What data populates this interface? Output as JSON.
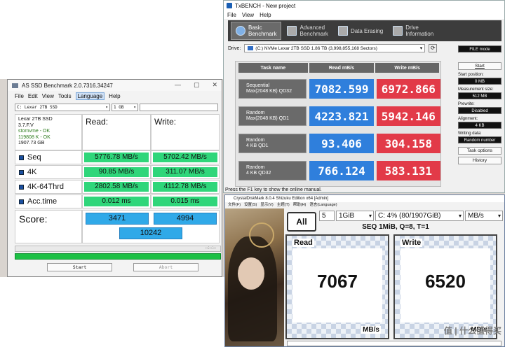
{
  "txbench": {
    "title": "TxBENCH - New project",
    "menu": [
      "File",
      "View",
      "Help"
    ],
    "tabs": [
      {
        "line1": "Basic",
        "line2": "Benchmark"
      },
      {
        "line1": "Advanced",
        "line2": "Benchmark"
      },
      {
        "line1": "Data Erasing",
        "line2": ""
      },
      {
        "line1": "Drive",
        "line2": "Information"
      }
    ],
    "drive_label": "Drive:",
    "drive_value": "(C:) NVMe Lexar 2TB SSD   1.86 TB (3,998,855,168 Sectors)",
    "file_mode": "FILE mode",
    "start": "Start",
    "start_position_label": "Start position:",
    "start_position": "0 MB",
    "measurement_size_label": "Measurement size:",
    "measurement_size": "512 MB",
    "prewrite_label": "Prewrite:",
    "prewrite": "Disabled",
    "alignment_label": "Alignment:",
    "alignment": "4 KB",
    "writing_data_label": "Writing data:",
    "writing_data": "Random number",
    "task_options": "Task options",
    "history": "History",
    "col_task": "Task name",
    "col_read": "Read mB/s",
    "col_write": "Write mB/s",
    "rows": [
      {
        "l1": "Sequential",
        "l2": "Max(2048 KB) QD32",
        "read": "7082.599",
        "write": "6972.866"
      },
      {
        "l1": "Random",
        "l2": "Max(2048 KB) QD1",
        "read": "4223.821",
        "write": "5942.146"
      },
      {
        "l1": "Random",
        "l2": "4 KB QD1",
        "read": "93.406",
        "write": "304.158"
      },
      {
        "l1": "Random",
        "l2": "4 KB QD32",
        "read": "766.124",
        "write": "583.131"
      }
    ],
    "status": "Press the F1 key to show the online manual."
  },
  "asssd": {
    "title": "AS SSD Benchmark 2.0.7316.34247",
    "menu": [
      "File",
      "Edit",
      "View",
      "Tools",
      "Language",
      "Help"
    ],
    "drive_select": "C: Lexar 2TB SSD",
    "size_select": "1 GB",
    "info": [
      "Lexar 2TB SSD",
      "3.7.F.V",
      "stornvme - OK",
      "119808 K - OK",
      "1907.73 GB"
    ],
    "read_head": "Read:",
    "write_head": "Write:",
    "tests": [
      {
        "name": "Seq",
        "read": "5776.78 MB/s",
        "write": "5702.42 MB/s"
      },
      {
        "name": "4K",
        "read": "90.85 MB/s",
        "write": "311.07 MB/s"
      },
      {
        "name": "4K-64Thrd",
        "read": "2802.58 MB/s",
        "write": "4112.78 MB/s"
      },
      {
        "name": "Acc.time",
        "read": "0.012 ms",
        "write": "0.015 ms"
      }
    ],
    "score_label": "Score:",
    "score_read": "3471",
    "score_write": "4994",
    "score_total": "10242",
    "progress_time": "--:--:--",
    "start": "Start",
    "abort": "Abort"
  },
  "cdm": {
    "title": "CrystalDiskMark 8.0.4 Shizuku Edition x64 [Admin]",
    "menu": [
      "文件(F)",
      "设置(S)",
      "显示(V)",
      "主题(T)",
      "帮助(H)",
      "语言(Language)"
    ],
    "all": "All",
    "count": "5",
    "size": "1GiB",
    "drive": "C: 4% (80/1907GiB)",
    "unit": "MB/s",
    "heading": "SEQ 1MiB, Q=8, T=1",
    "read_label": "Read",
    "write_label": "Write",
    "read_value": "7067",
    "write_value": "6520",
    "value_unit": "MB/s",
    "watermark": "值 | 什么值得买"
  }
}
